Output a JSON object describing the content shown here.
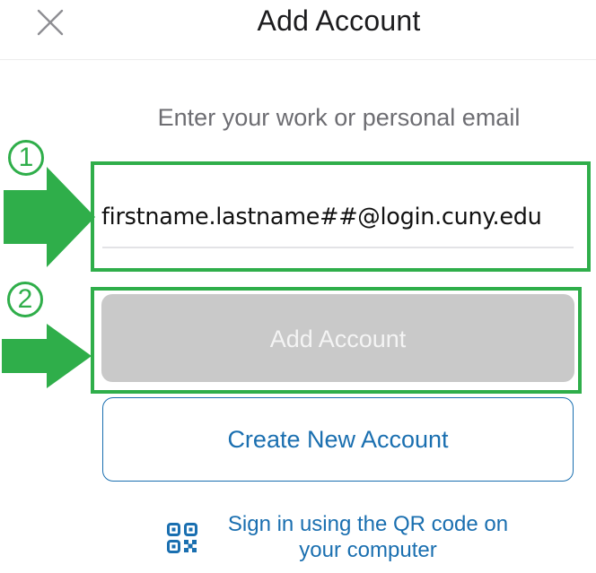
{
  "header": {
    "title": "Add Account",
    "close_icon": "close-icon"
  },
  "form": {
    "prompt": "Enter your work or personal email",
    "email_value": "firstname.lastname##@login.cuny.edu"
  },
  "annotations": {
    "step_1": "1",
    "step_2": "2",
    "accent_color": "#2fae4a"
  },
  "buttons": {
    "add_account_label": "Add Account",
    "create_new_account_label": "Create New Account",
    "add_account_state": "disabled"
  },
  "qr_signin": {
    "icon": "qr-code-icon",
    "line1": "Sign in using the QR code on",
    "line2": "your computer"
  },
  "colors": {
    "link_blue": "#1a6fb0",
    "disabled_gray": "#c9c9c9"
  }
}
